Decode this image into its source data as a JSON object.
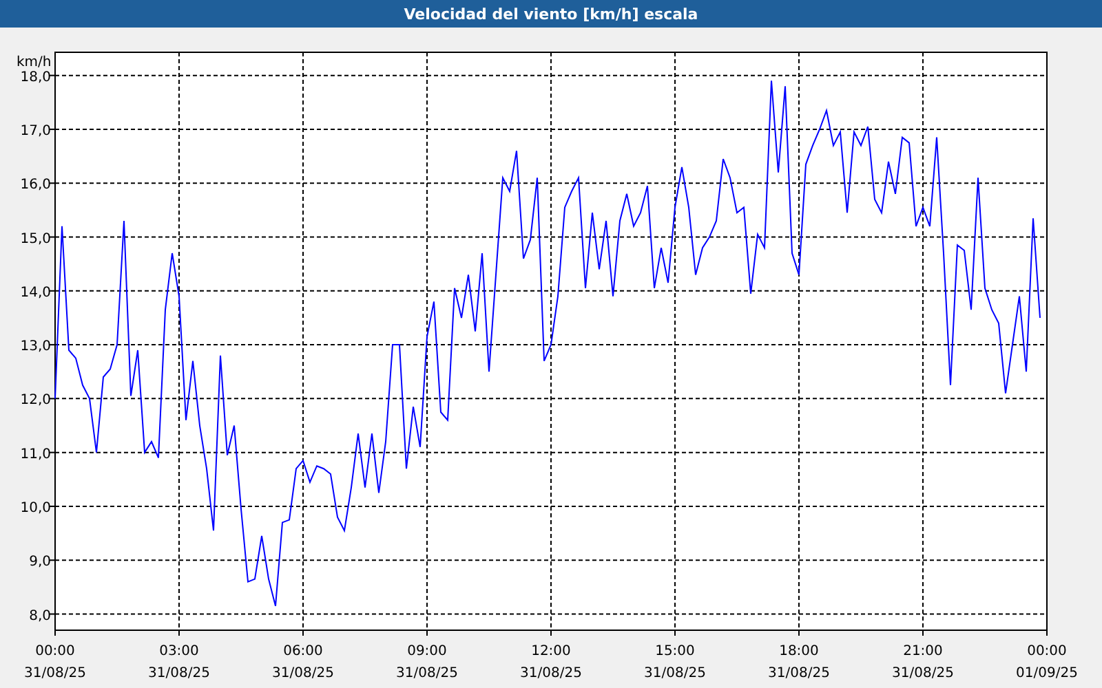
{
  "chart_data": {
    "type": "line",
    "grid": true,
    "title": "Velocidad del viento [km/h] escala",
    "ylabel": "km/h",
    "ylim": [
      7.7,
      18.43
    ],
    "yticks": [
      {
        "value": 8,
        "label": "8,0"
      },
      {
        "value": 9,
        "label": "9,0"
      },
      {
        "value": 10,
        "label": "10,0"
      },
      {
        "value": 11,
        "label": "11,0"
      },
      {
        "value": 12,
        "label": "12,0"
      },
      {
        "value": 13,
        "label": "13,0"
      },
      {
        "value": 14,
        "label": "14,0"
      },
      {
        "value": 15,
        "label": "15,0"
      },
      {
        "value": 16,
        "label": "16,0"
      },
      {
        "value": 17,
        "label": "17,0"
      },
      {
        "value": 18,
        "label": "18,0"
      }
    ],
    "categories": [
      "00:00\n31/08/25",
      null,
      null,
      null,
      null,
      null,
      null,
      null,
      null,
      null,
      null,
      null,
      null,
      null,
      null,
      null,
      null,
      null,
      "03:00\n31/08/25",
      null,
      null,
      null,
      null,
      null,
      null,
      null,
      null,
      null,
      null,
      null,
      null,
      null,
      null,
      null,
      null,
      null,
      "06:00\n31/08/25",
      null,
      null,
      null,
      null,
      null,
      null,
      null,
      null,
      null,
      null,
      null,
      null,
      null,
      null,
      null,
      null,
      null,
      "09:00\n31/08/25",
      null,
      null,
      null,
      null,
      null,
      null,
      null,
      null,
      null,
      null,
      null,
      null,
      null,
      null,
      null,
      null,
      null,
      "12:00\n31/08/25",
      null,
      null,
      null,
      null,
      null,
      null,
      null,
      null,
      null,
      null,
      null,
      null,
      null,
      null,
      null,
      null,
      null,
      "15:00\n31/08/25",
      null,
      null,
      null,
      null,
      null,
      null,
      null,
      null,
      null,
      null,
      null,
      null,
      null,
      null,
      null,
      null,
      null,
      "18:00\n31/08/25",
      null,
      null,
      null,
      null,
      null,
      null,
      null,
      null,
      null,
      null,
      null,
      null,
      null,
      null,
      null,
      null,
      null,
      "21:00\n31/08/25",
      null,
      null,
      null,
      null,
      null,
      null,
      null,
      null,
      null,
      null,
      null,
      null,
      null,
      null,
      null,
      null,
      null,
      "00:00\n01/09/25"
    ],
    "series": [
      {
        "color": "#0000ff",
        "values": [
          12.0,
          15.2,
          12.9,
          12.75,
          12.25,
          12.0,
          11.0,
          12.4,
          12.55,
          13.0,
          15.3,
          12.05,
          12.9,
          11.0,
          11.2,
          10.9,
          13.65,
          14.7,
          13.9,
          11.6,
          12.7,
          11.5,
          10.7,
          9.55,
          12.8,
          10.95,
          11.5,
          9.95,
          8.6,
          8.65,
          9.45,
          8.65,
          8.15,
          9.7,
          9.75,
          10.7,
          10.85,
          10.45,
          10.75,
          10.7,
          10.6,
          9.8,
          9.55,
          10.35,
          11.35,
          10.35,
          11.35,
          10.25,
          11.2,
          13.0,
          13.0,
          10.7,
          11.85,
          11.1,
          13.15,
          13.8,
          11.75,
          11.6,
          14.05,
          13.5,
          14.3,
          13.25,
          14.7,
          12.5,
          14.3,
          16.1,
          15.85,
          16.6,
          14.6,
          14.95,
          16.1,
          12.7,
          13.0,
          13.9,
          15.55,
          15.85,
          16.1,
          14.05,
          15.45,
          14.4,
          15.3,
          13.9,
          15.3,
          15.8,
          15.2,
          15.45,
          15.95,
          14.05,
          14.8,
          14.15,
          15.55,
          16.3,
          15.55,
          14.3,
          14.8,
          15.0,
          15.3,
          16.45,
          16.1,
          15.45,
          15.55,
          13.95,
          15.05,
          14.8,
          17.9,
          16.2,
          17.8,
          14.7,
          14.3,
          16.35,
          16.7,
          17.0,
          17.35,
          16.7,
          16.95,
          15.45,
          16.95,
          16.7,
          17.05,
          15.7,
          15.45,
          16.4,
          15.8,
          16.85,
          16.75,
          15.2,
          15.55,
          15.2,
          16.85,
          14.7,
          12.25,
          14.85,
          14.75,
          13.65,
          16.1,
          14.05,
          13.65,
          13.4,
          12.1,
          13.0,
          13.9,
          12.5,
          15.35,
          13.5,
          null
        ]
      }
    ]
  }
}
